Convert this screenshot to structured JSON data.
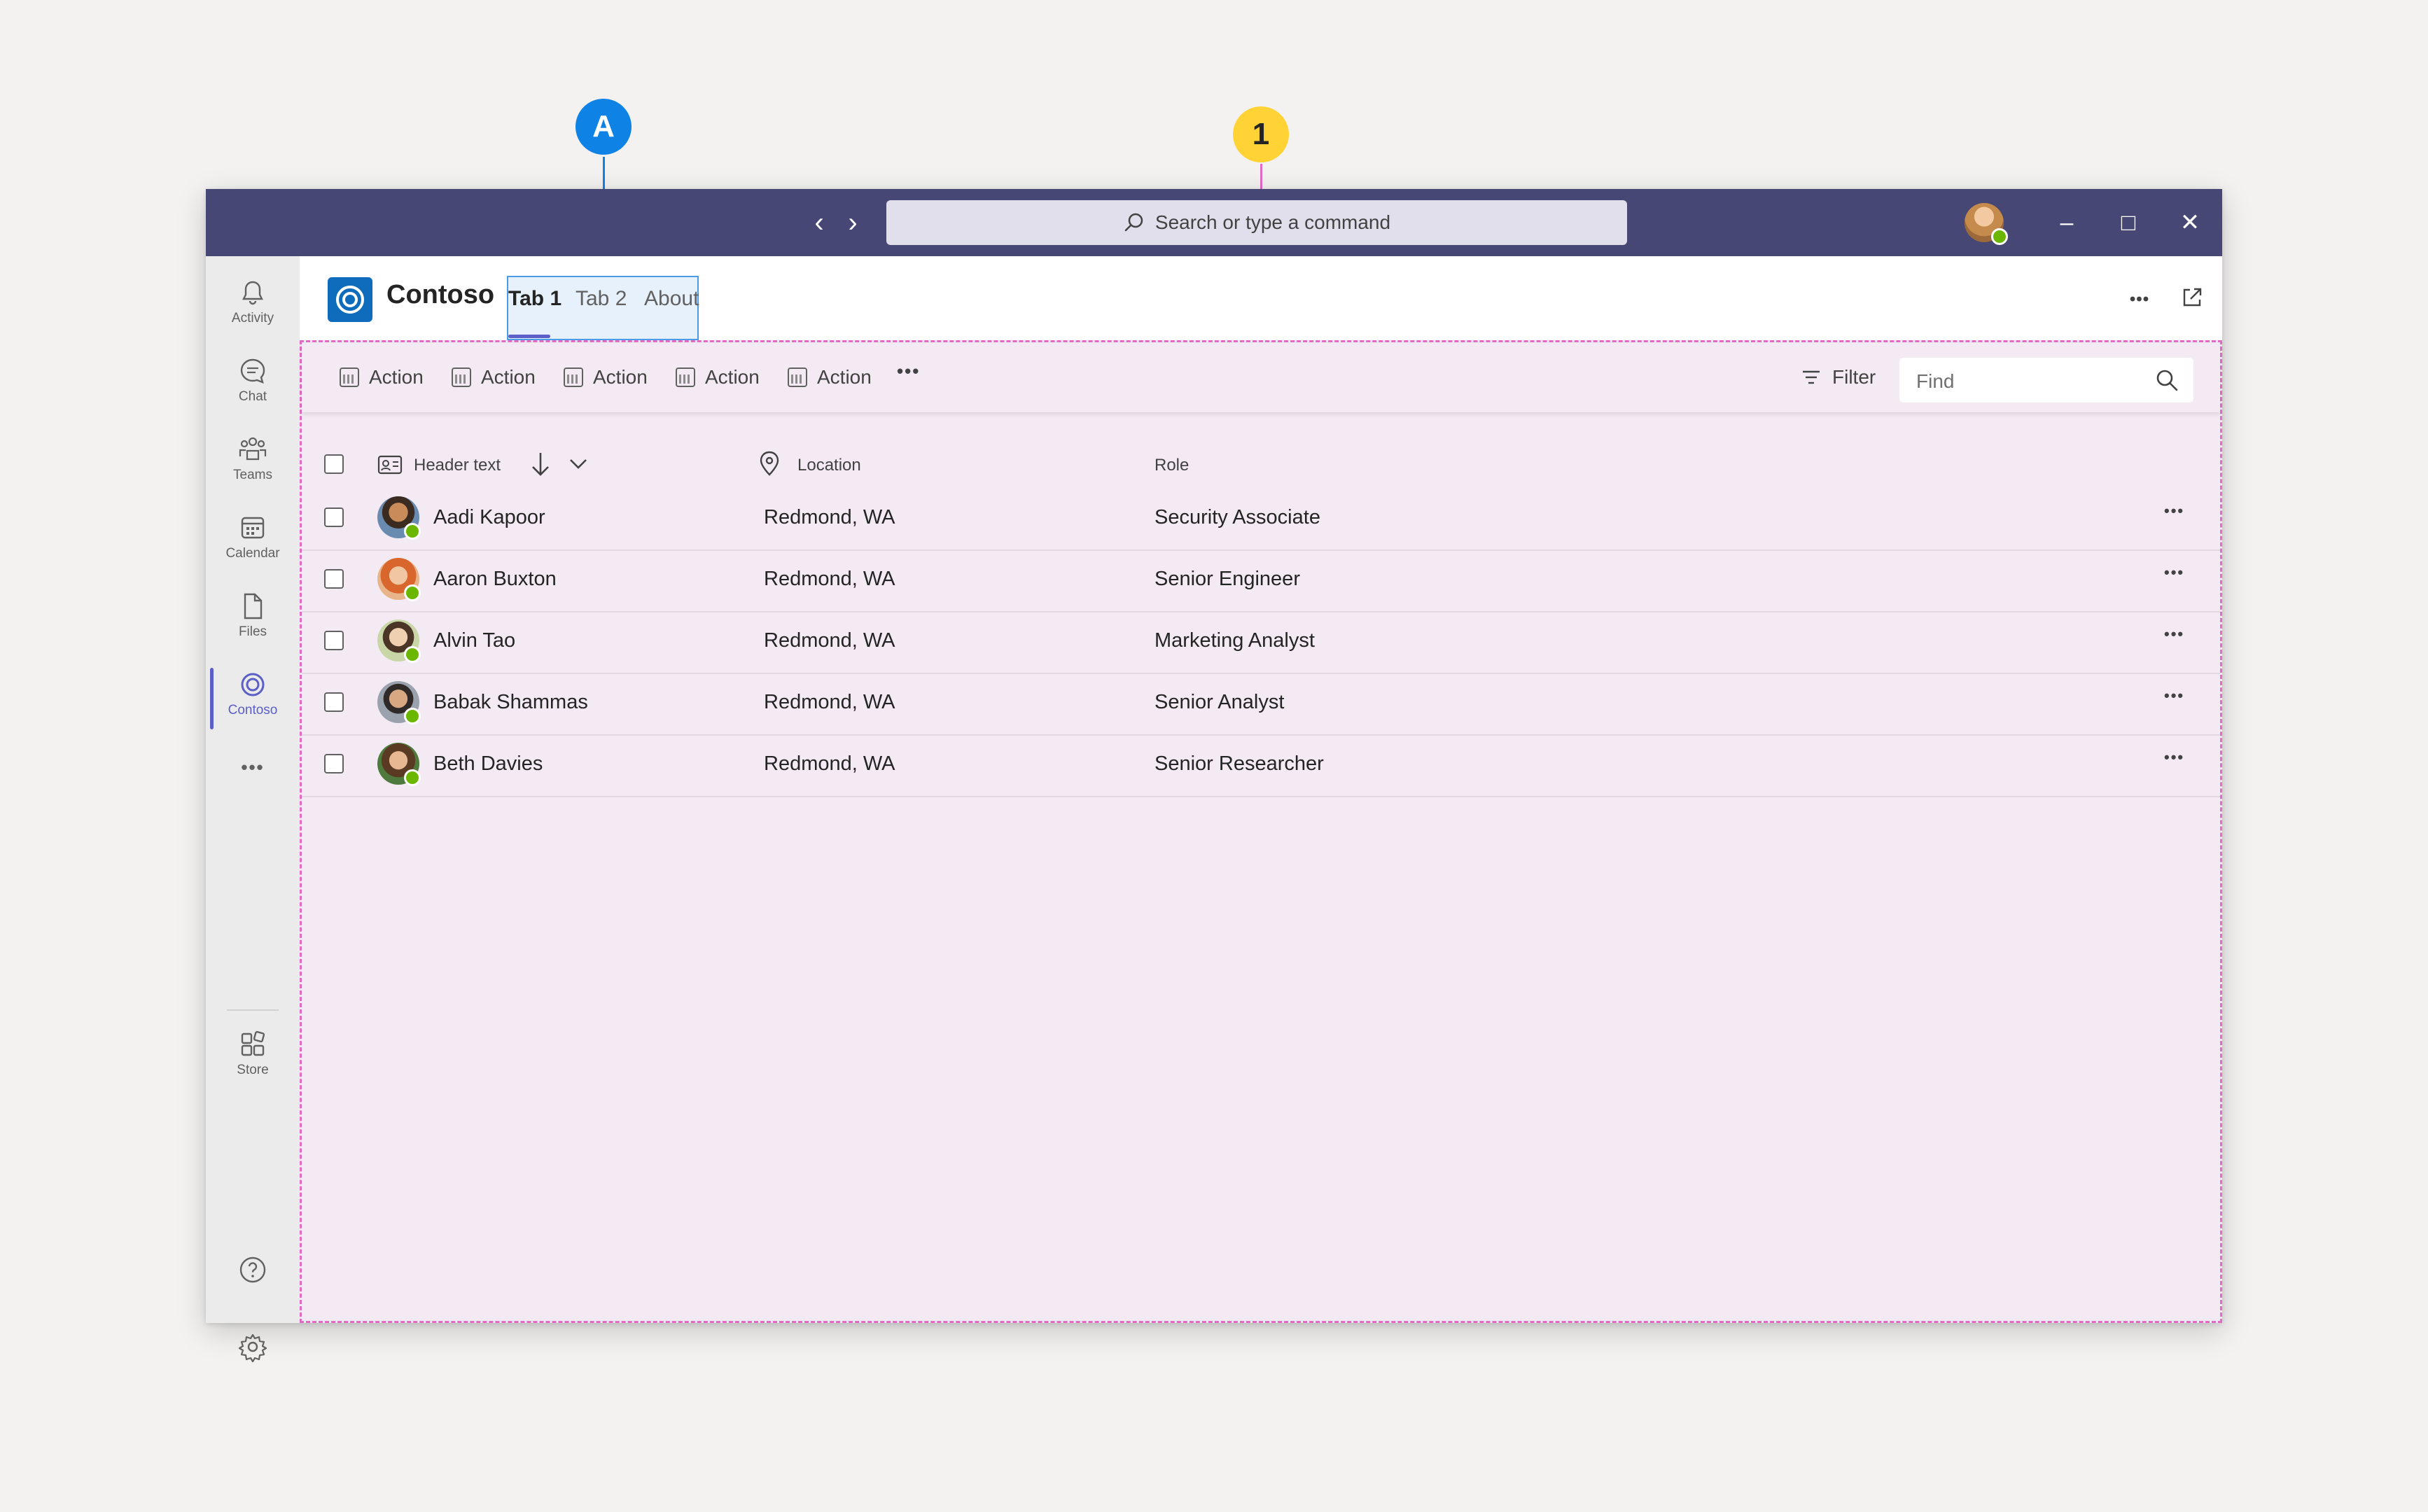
{
  "titlebar": {
    "back_glyph": "‹",
    "forward_glyph": "›",
    "search_placeholder": "Search or type a command",
    "minimize_glyph": "–",
    "maximize_glyph": "□",
    "close_glyph": "✕"
  },
  "rail": {
    "items": [
      {
        "label": "Activity",
        "icon": "bell-icon"
      },
      {
        "label": "Chat",
        "icon": "chat-icon"
      },
      {
        "label": "Teams",
        "icon": "teams-icon"
      },
      {
        "label": "Calendar",
        "icon": "calendar-icon"
      },
      {
        "label": "Files",
        "icon": "file-icon"
      },
      {
        "label": "Contoso",
        "icon": "contoso-icon",
        "active": true
      }
    ],
    "more_glyph": "•••",
    "store_label": "Store"
  },
  "app": {
    "name": "Contoso",
    "tabs": [
      {
        "label": "Tab 1",
        "active": true
      },
      {
        "label": "Tab 2"
      },
      {
        "label": "About"
      }
    ],
    "more_glyph": "•••"
  },
  "toolbar": {
    "actions": [
      "Action",
      "Action",
      "Action",
      "Action",
      "Action"
    ],
    "overflow_glyph": "•••",
    "filter_label": "Filter",
    "find_placeholder": "Find"
  },
  "table": {
    "headers": {
      "name": "Header text",
      "location": "Location",
      "role": "Role"
    },
    "rows": [
      {
        "name": "Aadi Kapoor",
        "location": "Redmond, WA",
        "role": "Security Associate"
      },
      {
        "name": "Aaron Buxton",
        "location": "Redmond, WA",
        "role": "Senior Engineer"
      },
      {
        "name": "Alvin Tao",
        "location": "Redmond, WA",
        "role": "Marketing Analyst"
      },
      {
        "name": "Babak Shammas",
        "location": "Redmond, WA",
        "role": "Senior Analyst"
      },
      {
        "name": "Beth Davies",
        "location": "Redmond, WA",
        "role": "Senior Researcher"
      }
    ],
    "row_more_glyph": "•••"
  },
  "callouts": {
    "a": "A",
    "one": "1"
  },
  "colors": {
    "titlebar": "#464775",
    "accent": "#5b5fc7",
    "content_bg": "#f4eaf4",
    "highlight_border": "#e36bc8",
    "callout_a": "#0f82e6",
    "callout_1": "#ffd335",
    "presence": "#6bb700"
  }
}
